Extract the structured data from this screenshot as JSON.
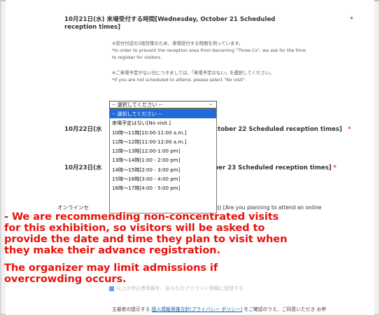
{
  "form": {
    "oct21_title": "10月21日(水) 来場受付する時間[Wednesday, October 21 Scheduled reception times]",
    "required_mark": "*",
    "note1_jp": "※受付付近の3密対策のため、来場受付する時間を伺っています。",
    "note1_en": "*In order to prevent the reception area from becoming \"Three Cs\", we ask for the time",
    "note1_en2": "to register for visitors.",
    "note2_jp": "※ご来場予定がない日につきましては、「来場予定はない」を選択してください。",
    "note2_en": "*If you are not scheduled to attend, please select \"No visit\".",
    "select_value": "-- 選択してください --",
    "options": [
      "-- 選択してください --",
      "来場予定はない[No visit.]",
      "10時～11時[10:00-11:00 a.m.]",
      "11時～12時[11:00-12:00 a.m.]",
      "12時～13時[12:00-1:00 pm]",
      "13時～14時[1:00 - 2:00 pm]",
      "14時～15時[2:00 - 3:00 pm]",
      "15時～16時[3:00 - 4:00 pm]",
      "16時～17時[4:00 - 5:00 pm]"
    ],
    "oct22_prefix": "10月22日(水",
    "oct22_suffix": "ctober 22 Scheduled reception times]",
    "oct23_prefix": "10月23日(水",
    "oct23_suffix": "ber 23 Scheduled reception times]",
    "online_prefix": "オンラインセ",
    "online_suffix": "内) [Are you planning to attend an online",
    "consent_text": "以上の申込者情報を、あなたのアカウント情報に登録する",
    "footer_prefix": "主催者の提示する ",
    "footer_link": "個人情報保護方針(プライバシー ポリシー)",
    "footer_suffix": " をご確認のうえ、ご同意いただき お申"
  },
  "overlay": {
    "line1": "- We are recommending non-concentrated visits",
    "line2": "for this exhibition, so visitors will be asked to",
    "line3": "provide the date and time they plan to visit when",
    "line4": "they make their advance registration.",
    "line5": "The organizer may limit admissions if",
    "line6": "overcrowding occurs."
  },
  "colors": {
    "overlay_text": "#e8120a",
    "selected_option": "#1e6cd9",
    "required": "#e0433b"
  },
  "icons": [
    "chevron-down-icon",
    "checkbox-icon"
  ]
}
